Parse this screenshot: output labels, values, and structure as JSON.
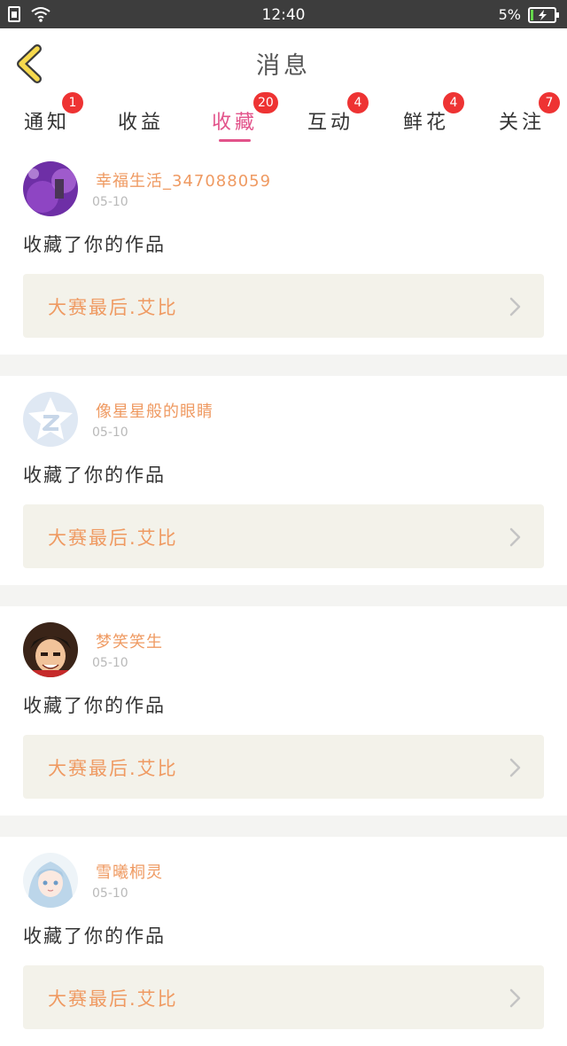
{
  "status_bar": {
    "time": "12:40",
    "battery_percent": "5%"
  },
  "header": {
    "title": "消息",
    "back_icon": "chevron-left-icon"
  },
  "tabs": [
    {
      "label": "通知",
      "badge": "1",
      "active": false
    },
    {
      "label": "收益",
      "badge": "",
      "active": false
    },
    {
      "label": "收藏",
      "badge": "20",
      "active": true
    },
    {
      "label": "互动",
      "badge": "4",
      "active": false
    },
    {
      "label": "鲜花",
      "badge": "4",
      "active": false
    },
    {
      "label": "关注",
      "badge": "7",
      "active": false
    }
  ],
  "colors": {
    "accent": "#e2538a",
    "orange_text": "#ef9a62",
    "badge": "#ee3333",
    "card_bg": "#f3f2ea"
  },
  "messages": [
    {
      "username": "幸福生活_347088059",
      "date": "05-10",
      "action": "收藏了你的作品",
      "work_title": "大赛最后.艾比",
      "avatar": "purple-photo-avatar"
    },
    {
      "username": "像星星般的眼睛",
      "date": "05-10",
      "action": "收藏了你的作品",
      "work_title": "大赛最后.艾比",
      "avatar": "default-qq-avatar"
    },
    {
      "username": "梦笑笑生",
      "date": "05-10",
      "action": "收藏了你的作品",
      "work_title": "大赛最后.艾比",
      "avatar": "anime-pirate-avatar"
    },
    {
      "username": "雪曦桐灵",
      "date": "05-10",
      "action": "收藏了你的作品",
      "work_title": "大赛最后.艾比",
      "avatar": "anime-girl-avatar"
    }
  ]
}
